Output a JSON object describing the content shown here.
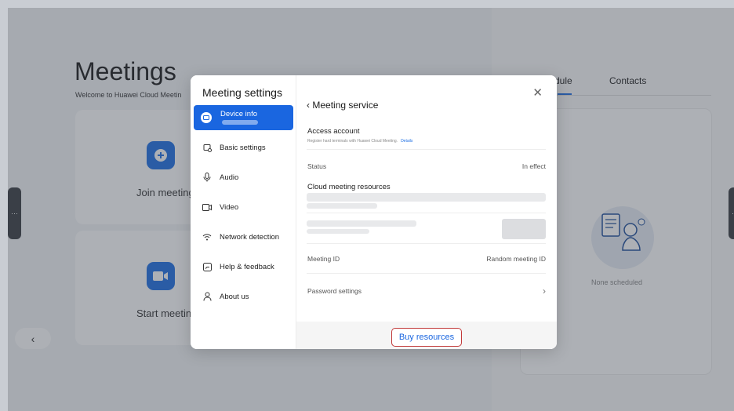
{
  "background": {
    "title": "Meetings",
    "welcome": "Welcome to Huawei Cloud Meetin",
    "join_label": "Join meeting",
    "start_label": "Start meeting",
    "tab_schedule": "dule",
    "tab_contacts": "Contacts",
    "none_scheduled": "None scheduled"
  },
  "modal": {
    "title": "Meeting settings",
    "nav": [
      {
        "label": "Device info",
        "icon": "device-icon"
      },
      {
        "label": "Basic settings",
        "icon": "basic-settings-icon"
      },
      {
        "label": "Audio",
        "icon": "microphone-icon"
      },
      {
        "label": "Video",
        "icon": "video-icon"
      },
      {
        "label": "Network detection",
        "icon": "wifi-icon"
      },
      {
        "label": "Help & feedback",
        "icon": "help-icon"
      },
      {
        "label": "About us",
        "icon": "user-icon"
      }
    ],
    "main": {
      "back_title": "Meeting service",
      "access_account": "Access account",
      "access_sub": "Register hard terminals with Huawei Cloud Meeting.",
      "details_link": "Details",
      "status_label": "Status",
      "status_value": "In effect",
      "resources_label": "Cloud meeting resources",
      "meeting_id_label": "Meeting ID",
      "meeting_id_value": "Random meeting ID",
      "password_label": "Password settings",
      "buy_button": "Buy resources"
    }
  },
  "colors": {
    "accent": "#1a66e0",
    "buy_border": "#c23a3a"
  }
}
